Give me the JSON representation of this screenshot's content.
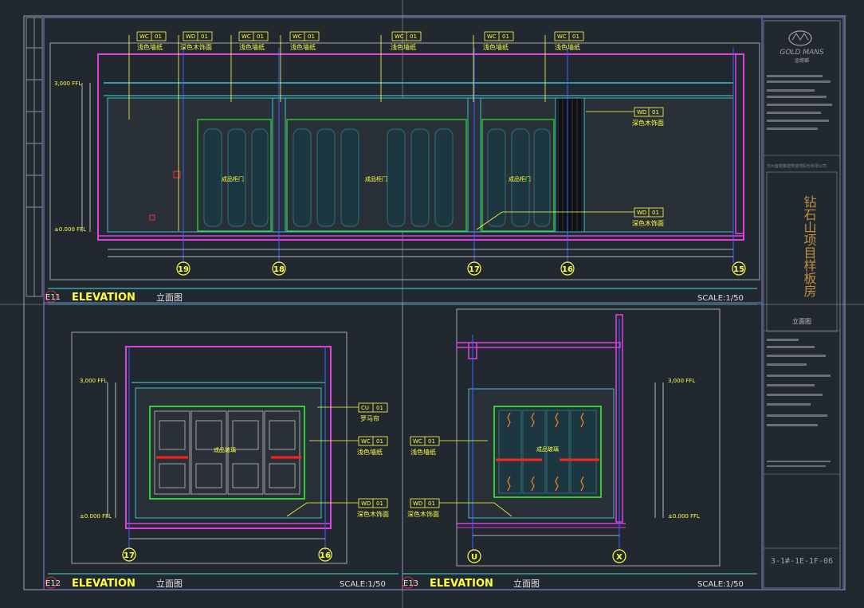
{
  "brand": {
    "logo_text": "GOLD MANS",
    "logo_sub": "金螳螂"
  },
  "title_block": {
    "project": "钻石山项目样板房",
    "company_line": "苏州金螳螂建筑装饰股份有限公司",
    "drawing_title": "立面图",
    "drawing_no": "3-1#-1E-1F-06"
  },
  "panels": {
    "e11": {
      "id": "E11",
      "title": "ELEVATION",
      "subtitle": "立面图",
      "scale": "SCALE:1/50"
    },
    "e12": {
      "id": "E12",
      "title": "ELEVATION",
      "subtitle": "立面图",
      "scale": "SCALE:1/50"
    },
    "e13": {
      "id": "E13",
      "title": "ELEVATION",
      "subtitle": "立面图",
      "scale": "SCALE:1/50"
    }
  },
  "tags": {
    "wc01": {
      "code": "WC",
      "num": "01",
      "desc": "浅色墙纸"
    },
    "wd01": {
      "code": "WD",
      "num": "01",
      "desc": "深色木饰面"
    },
    "wc01b": {
      "code": "WC",
      "num": "01",
      "desc": "浅色墙纸"
    },
    "cu01": {
      "code": "CU",
      "num": "01",
      "desc": "罗马帘"
    }
  },
  "grid_labels": {
    "e11": [
      "19",
      "18",
      "17",
      "16",
      "15"
    ],
    "e12": [
      "17",
      "16"
    ],
    "e13": [
      "U",
      "X"
    ]
  },
  "door_labels": {
    "cabinet": "成品柜门",
    "glass": "成品玻璃"
  },
  "levels": {
    "ceiling": "3,000 FFL",
    "floor": "±0.000 FFL"
  }
}
